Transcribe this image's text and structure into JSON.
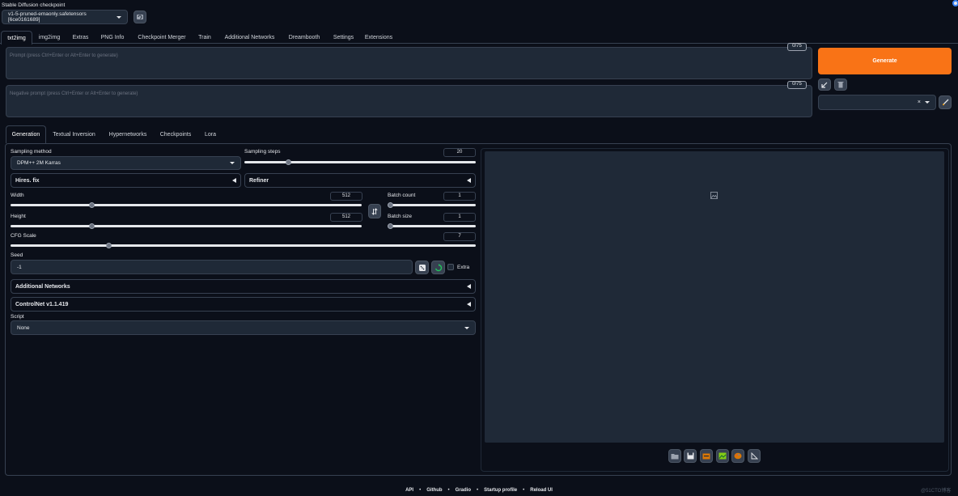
{
  "checkpoint": {
    "label": "Stable Diffusion checkpoint",
    "selected": "v1-5-pruned-emaonly.safetensors [6ce0161689]"
  },
  "main_tabs": [
    "txt2img",
    "img2img",
    "Extras",
    "PNG Info",
    "Checkpoint Merger",
    "Train",
    "Additional Networks",
    "Dreambooth",
    "Settings",
    "Extensions"
  ],
  "prompt": {
    "placeholder": "Prompt (press Ctrl+Enter or Alt+Enter to generate)",
    "counter": "0/75"
  },
  "negative_prompt": {
    "placeholder": "Negative prompt (press Ctrl+Enter or Alt+Enter to generate)",
    "counter": "0/75"
  },
  "generate_label": "Generate",
  "sub_tabs": [
    "Generation",
    "Textual Inversion",
    "Hypernetworks",
    "Checkpoints",
    "Lora"
  ],
  "sampling_method": {
    "label": "Sampling method",
    "value": "DPM++ 2M Karras"
  },
  "sampling_steps": {
    "label": "Sampling steps",
    "value": "20",
    "fraction": 0.19
  },
  "hires_fix": "Hires. fix",
  "refiner": "Refiner",
  "width": {
    "label": "Width",
    "value": "512",
    "fraction": 0.23
  },
  "height": {
    "label": "Height",
    "value": "512",
    "fraction": 0.23
  },
  "batch_count": {
    "label": "Batch count",
    "value": "1",
    "fraction": 0.0
  },
  "batch_size": {
    "label": "Batch size",
    "value": "1",
    "fraction": 0.0
  },
  "cfg_scale": {
    "label": "CFG Scale",
    "value": "7",
    "fraction": 0.21
  },
  "seed": {
    "label": "Seed",
    "value": "-1",
    "extra_label": "Extra"
  },
  "additional_networks": "Additional Networks",
  "controlnet": "ControlNet v1.1.419",
  "script": {
    "label": "Script",
    "value": "None"
  },
  "footer": [
    "API",
    "Github",
    "Gradio",
    "Startup profile",
    "Reload UI"
  ],
  "footer_separator": "•",
  "watermark": "@51CTO博客",
  "colors": {
    "accent": "#f97316",
    "background": "#0b0f19",
    "panel": "#1f2937"
  }
}
